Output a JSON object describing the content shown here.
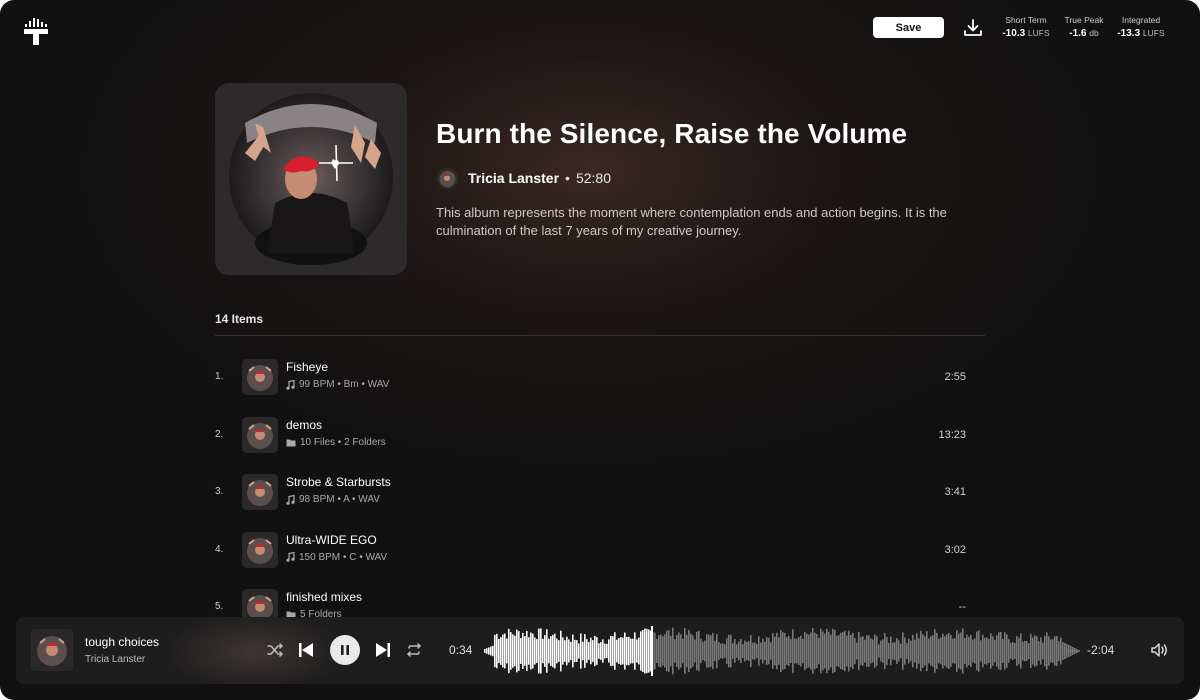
{
  "header": {
    "save_label": "Save",
    "meters": [
      {
        "label": "Short Term",
        "value": "-10.3",
        "unit": "LUFS"
      },
      {
        "label": "True Peak",
        "value": "-1.6",
        "unit": "db"
      },
      {
        "label": "Integrated",
        "value": "-13.3",
        "unit": "LUFS"
      }
    ]
  },
  "album": {
    "title": "Burn the Silence, Raise the Volume",
    "artist": "Tricia Lanster",
    "separator": "•",
    "duration": "52:80",
    "description": "This album represents the moment where contemplation ends and action begins. It is the culmination of the last 7 years of my creative journey."
  },
  "list": {
    "count_label": "14 Items",
    "tracks": [
      {
        "num": "1.",
        "title": "Fisheye",
        "meta": "99 BPM • Bm • WAV",
        "meta_icon": "music-note-icon",
        "duration": "2:55"
      },
      {
        "num": "2.",
        "title": "demos",
        "meta": "10 Files • 2 Folders",
        "meta_icon": "folder-icon",
        "duration": "13:23"
      },
      {
        "num": "3.",
        "title": "Strobe & Starbursts",
        "meta": "98 BPM • A • WAV",
        "meta_icon": "music-note-icon",
        "duration": "3:41"
      },
      {
        "num": "4.",
        "title": "Ultra-WIDE EGO",
        "meta": "150 BPM • C • WAV",
        "meta_icon": "music-note-icon",
        "duration": "3:02"
      },
      {
        "num": "5.",
        "title": "finished mixes",
        "meta": "5 Folders",
        "meta_icon": "folder-icon",
        "duration": "--"
      }
    ]
  },
  "player": {
    "title": "tough choices",
    "artist": "Tricia Lanster",
    "elapsed": "0:34",
    "remaining": "-2:04",
    "progress": 0.25
  }
}
